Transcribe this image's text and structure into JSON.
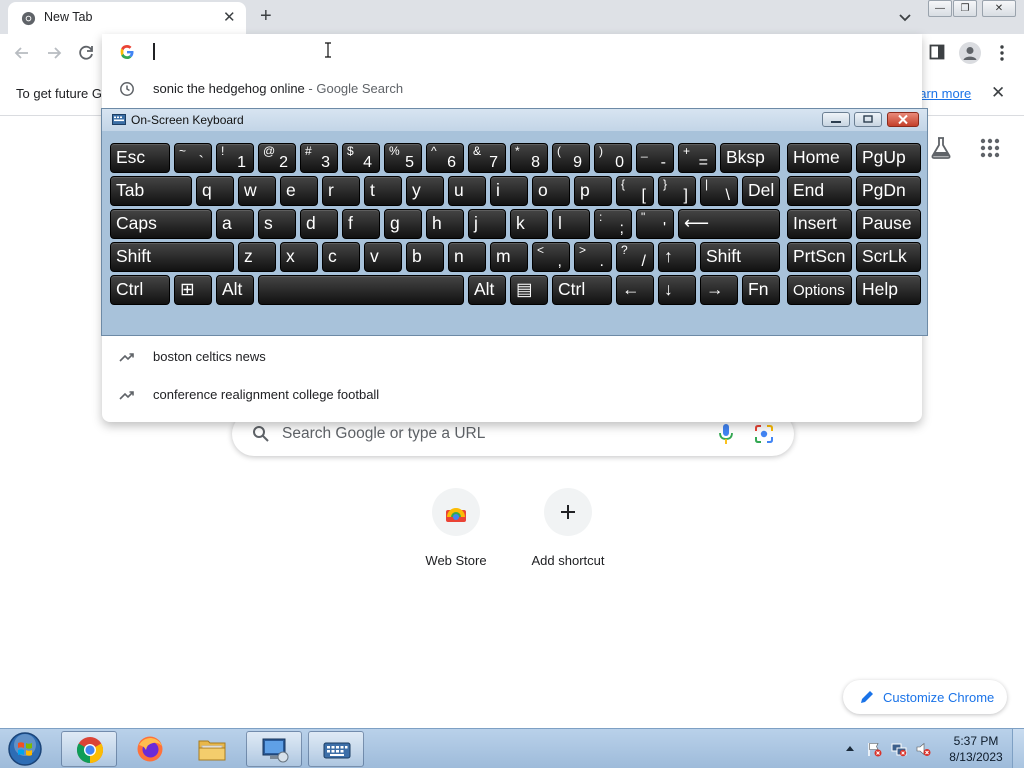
{
  "browser": {
    "tab": {
      "title": "New Tab",
      "close_glyph": "✕"
    },
    "new_tab_glyph": "+",
    "window_buttons": {
      "minimize": "—",
      "maximize": "❐",
      "close": "✕"
    }
  },
  "omnibox": {
    "value": "",
    "suggestions": [
      {
        "text": "sonic the hedgehog online",
        "suffix": " - Google Search",
        "icon": "history-icon"
      },
      {
        "text": "boston celtics news",
        "suffix": "",
        "icon": "trending-icon"
      },
      {
        "text": "conference realignment college football",
        "suffix": "",
        "icon": "trending-icon"
      }
    ]
  },
  "infobar": {
    "text": "To get future G",
    "link": "earn more",
    "close_glyph": "✕"
  },
  "ntp": {
    "search_placeholder": "Search Google or type a URL",
    "shortcuts": [
      {
        "label": "Web Store",
        "icon": "webstore-icon"
      },
      {
        "label": "Add shortcut",
        "icon": "plus-icon"
      }
    ],
    "customize_label": "Customize Chrome"
  },
  "osk": {
    "title": "On-Screen Keyboard",
    "rows": [
      [
        {
          "id": "esc",
          "main": "Esc"
        },
        {
          "id": "tilde",
          "main": "`",
          "shift": "~"
        },
        {
          "id": "1",
          "main": "1",
          "shift": "!"
        },
        {
          "id": "2",
          "main": "2",
          "shift": "@"
        },
        {
          "id": "3",
          "main": "3",
          "shift": "#"
        },
        {
          "id": "4",
          "main": "4",
          "shift": "$"
        },
        {
          "id": "5",
          "main": "5",
          "shift": "%"
        },
        {
          "id": "6",
          "main": "6",
          "shift": "^"
        },
        {
          "id": "7",
          "main": "7",
          "shift": "&"
        },
        {
          "id": "8",
          "main": "8",
          "shift": "*"
        },
        {
          "id": "9",
          "main": "9",
          "shift": "("
        },
        {
          "id": "0",
          "main": "0",
          "shift": ")"
        },
        {
          "id": "minus",
          "main": "-",
          "shift": "_"
        },
        {
          "id": "equals",
          "main": "=",
          "shift": "+"
        },
        {
          "id": "bksp",
          "main": "Bksp"
        },
        {
          "id": "home",
          "main": "Home"
        },
        {
          "id": "pgup",
          "main": "PgUp"
        }
      ],
      [
        {
          "id": "tab",
          "main": "Tab"
        },
        {
          "id": "q",
          "main": "q"
        },
        {
          "id": "w",
          "main": "w"
        },
        {
          "id": "e",
          "main": "e"
        },
        {
          "id": "r",
          "main": "r"
        },
        {
          "id": "t",
          "main": "t"
        },
        {
          "id": "y",
          "main": "y"
        },
        {
          "id": "u",
          "main": "u"
        },
        {
          "id": "i",
          "main": "i"
        },
        {
          "id": "o",
          "main": "o"
        },
        {
          "id": "p",
          "main": "p"
        },
        {
          "id": "lbracket",
          "main": "[",
          "shift": "{"
        },
        {
          "id": "rbracket",
          "main": "]",
          "shift": "}"
        },
        {
          "id": "backslash",
          "main": "\\",
          "shift": "|"
        },
        {
          "id": "del",
          "main": "Del"
        },
        {
          "id": "end",
          "main": "End"
        },
        {
          "id": "pgdn",
          "main": "PgDn"
        }
      ],
      [
        {
          "id": "caps",
          "main": "Caps"
        },
        {
          "id": "a",
          "main": "a"
        },
        {
          "id": "s",
          "main": "s"
        },
        {
          "id": "d",
          "main": "d"
        },
        {
          "id": "f",
          "main": "f"
        },
        {
          "id": "g",
          "main": "g"
        },
        {
          "id": "h",
          "main": "h"
        },
        {
          "id": "j",
          "main": "j"
        },
        {
          "id": "k",
          "main": "k"
        },
        {
          "id": "l",
          "main": "l"
        },
        {
          "id": "semicolon",
          "main": ";",
          "shift": ":"
        },
        {
          "id": "quote",
          "main": "'",
          "shift": "\""
        },
        {
          "id": "enter",
          "main": "⟵"
        },
        {
          "id": "insert",
          "main": "Insert"
        },
        {
          "id": "pause",
          "main": "Pause"
        }
      ],
      [
        {
          "id": "lshift",
          "main": "Shift"
        },
        {
          "id": "z",
          "main": "z"
        },
        {
          "id": "x",
          "main": "x"
        },
        {
          "id": "c",
          "main": "c"
        },
        {
          "id": "v",
          "main": "v"
        },
        {
          "id": "b",
          "main": "b"
        },
        {
          "id": "n",
          "main": "n"
        },
        {
          "id": "m",
          "main": "m"
        },
        {
          "id": "comma",
          "main": ",",
          "shift": "<"
        },
        {
          "id": "period",
          "main": ".",
          "shift": ">"
        },
        {
          "id": "slash",
          "main": "/",
          "shift": "?"
        },
        {
          "id": "up",
          "main": "↑"
        },
        {
          "id": "rshift",
          "main": "Shift"
        },
        {
          "id": "prtscn",
          "main": "PrtScn"
        },
        {
          "id": "scrlk",
          "main": "ScrLk"
        }
      ],
      [
        {
          "id": "lctrl",
          "main": "Ctrl"
        },
        {
          "id": "win",
          "main": "⊞"
        },
        {
          "id": "lalt",
          "main": "Alt"
        },
        {
          "id": "space",
          "main": ""
        },
        {
          "id": "ralt",
          "main": "Alt"
        },
        {
          "id": "menu",
          "main": "▤"
        },
        {
          "id": "rctrl",
          "main": "Ctrl"
        },
        {
          "id": "left",
          "main": "←"
        },
        {
          "id": "down",
          "main": "↓"
        },
        {
          "id": "right",
          "main": "→"
        },
        {
          "id": "fn",
          "main": "Fn"
        },
        {
          "id": "options",
          "main": "Options"
        },
        {
          "id": "help",
          "main": "Help"
        }
      ]
    ]
  },
  "taskbar": {
    "apps": [
      {
        "name": "chrome",
        "icon": "chrome-icon",
        "active": true
      },
      {
        "name": "firefox",
        "icon": "firefox-icon",
        "active": false
      },
      {
        "name": "explorer",
        "icon": "folder-icon",
        "active": false
      },
      {
        "name": "remote-desktop",
        "icon": "remote-desktop-icon",
        "active": true
      },
      {
        "name": "on-screen-keyboard",
        "icon": "keyboard-icon",
        "active": true
      }
    ],
    "clock": {
      "time": "5:37 PM",
      "date": "8/13/2023"
    }
  },
  "colors": {
    "accent": "#1a73e8",
    "osk_background": "#a8c2da",
    "key_background": "#1e1e1e",
    "taskbar": "#b1cbe6"
  }
}
